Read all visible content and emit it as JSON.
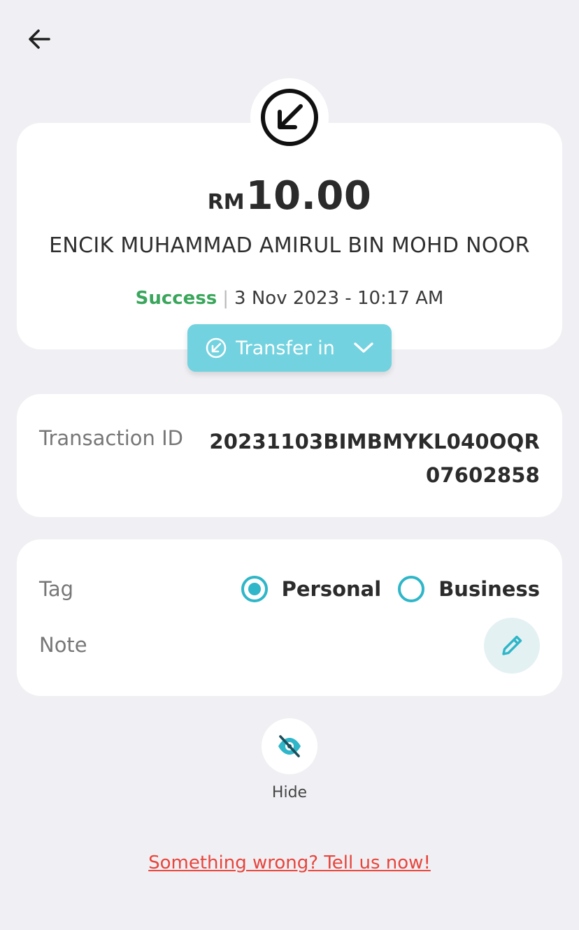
{
  "header": {
    "back_icon": "arrow-left-icon"
  },
  "transaction": {
    "direction_icon": "arrow-down-left-circle-icon",
    "currency": "RM",
    "amount": "10.00",
    "payer_name": "ENCIK MUHAMMAD AMIRUL BIN MOHD NOOR",
    "status": "Success",
    "status_color": "#3aa65c",
    "datetime": "3 Nov 2023 - 10:17 AM",
    "type_label": "Transfer in",
    "type_chip_color": "#72d2df"
  },
  "details": {
    "transaction_id_label": "Transaction ID",
    "transaction_id": "20231103BIMBMYKL040OQR07602858"
  },
  "tag": {
    "label": "Tag",
    "options": [
      {
        "label": "Personal",
        "selected": true
      },
      {
        "label": "Business",
        "selected": false
      }
    ],
    "accent_color": "#2fb6c8",
    "note_label": "Note",
    "edit_icon": "pencil-icon"
  },
  "actions": {
    "hide_icon": "eye-off-icon",
    "hide_label": "Hide",
    "report_link": "Something wrong? Tell us now!",
    "report_color": "#e8453c"
  }
}
